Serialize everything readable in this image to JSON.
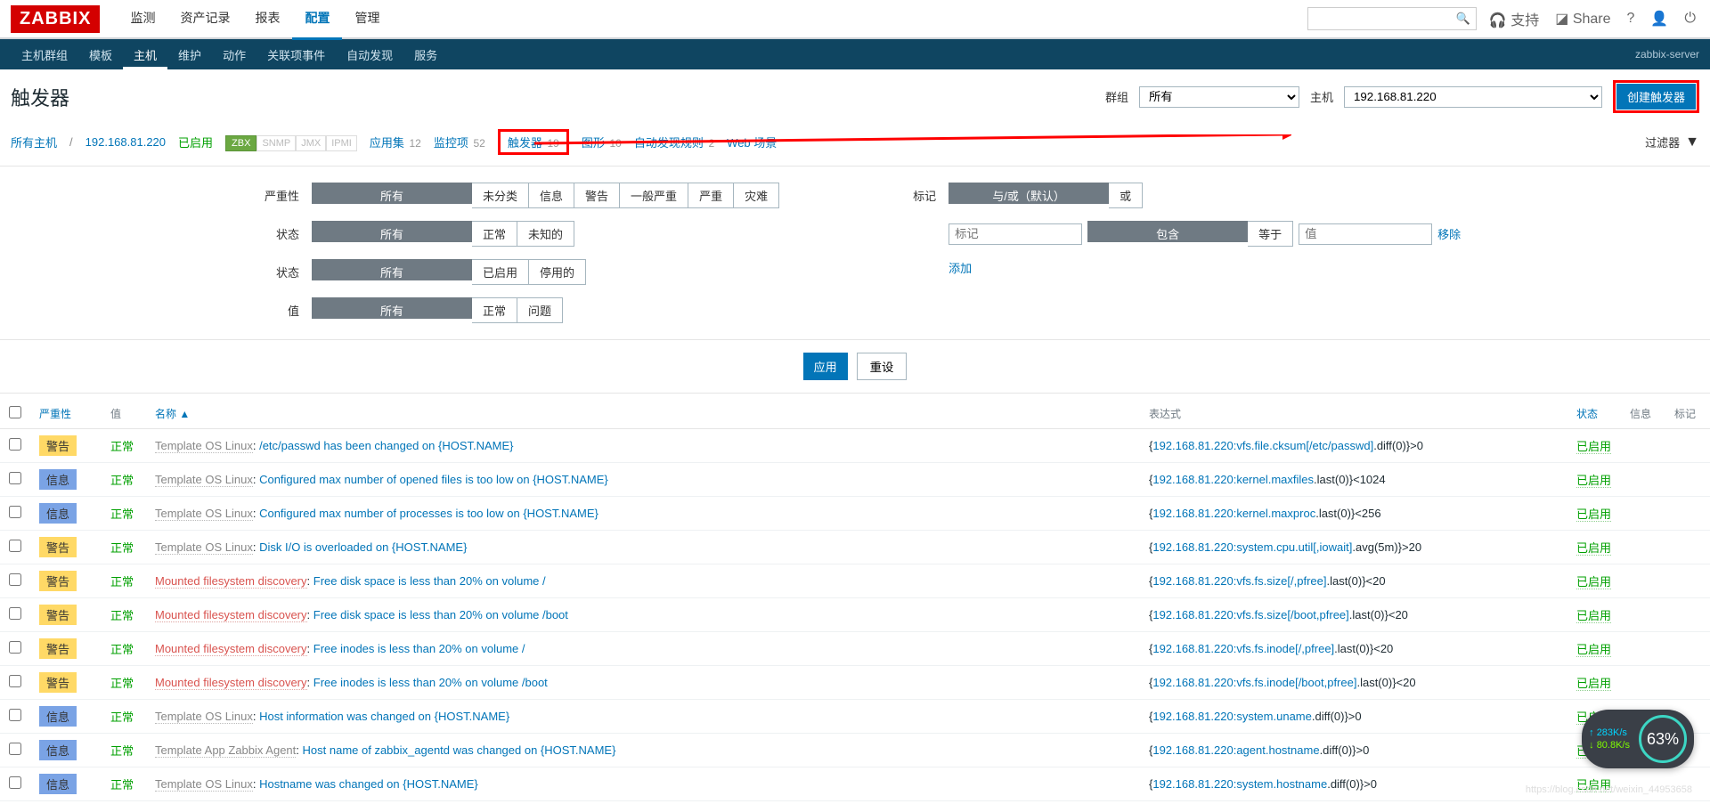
{
  "logo": "ZABBIX",
  "topnav": {
    "items": [
      "监测",
      "资产记录",
      "报表",
      "配置",
      "管理"
    ],
    "active": 3
  },
  "topright": {
    "support": "支持",
    "share": "Share"
  },
  "subnav": {
    "items": [
      "主机群组",
      "模板",
      "主机",
      "维护",
      "动作",
      "关联项事件",
      "自动发现",
      "服务"
    ],
    "active": 2,
    "server": "zabbix-server"
  },
  "header": {
    "title": "触发器",
    "group_label": "群组",
    "group_value": "所有",
    "host_label": "主机",
    "host_value": "192.168.81.220",
    "create_btn": "创建触发器"
  },
  "tabs": {
    "all_hosts": "所有主机",
    "host": "192.168.81.220",
    "enabled": "已启用",
    "zbx": "ZBX",
    "snmp": "SNMP",
    "jmx": "JMX",
    "ipmi": "IPMI",
    "apps": "应用集",
    "apps_n": "12",
    "items": "监控项",
    "items_n": "52",
    "triggers": "触发器",
    "triggers_n": "19",
    "graphs": "图形",
    "graphs_n": "10",
    "discovery": "自动发现规则",
    "discovery_n": "2",
    "web": "Web 场景",
    "filter": "过滤器"
  },
  "filter": {
    "severity_lbl": "严重性",
    "severity_opts": [
      "所有",
      "未分类",
      "信息",
      "警告",
      "一般严重",
      "严重",
      "灾难"
    ],
    "state_lbl": "状态",
    "state_opts": [
      "所有",
      "正常",
      "未知的"
    ],
    "status_lbl": "状态",
    "status_opts": [
      "所有",
      "已启用",
      "停用的"
    ],
    "value_lbl": "值",
    "value_opts": [
      "所有",
      "正常",
      "问题"
    ],
    "tag_lbl": "标记",
    "tag_mode": [
      "与/或（默认）",
      "或"
    ],
    "tag_name_ph": "标记",
    "tag_op": [
      "包含",
      "等于"
    ],
    "tag_val_ph": "值",
    "remove": "移除",
    "add": "添加",
    "apply": "应用",
    "reset": "重设"
  },
  "cols": {
    "severity": "严重性",
    "value": "值",
    "name": "名称",
    "expr": "表达式",
    "status": "状态",
    "info": "信息",
    "tags": "标记"
  },
  "sev": {
    "warn": "警告",
    "info": "信息"
  },
  "vals": {
    "ok": "正常"
  },
  "status": {
    "enabled": "已启用"
  },
  "src": {
    "tpl_linux": "Template OS Linux",
    "mfs": "Mounted filesystem discovery",
    "tpl_agent": "Template App Zabbix Agent"
  },
  "rows": [
    {
      "sev": "warn",
      "src": "tpl_linux",
      "name": "/etc/passwd has been changed on {HOST.NAME}",
      "expr_l": "192.168.81.220:vfs.file.cksum[/etc/passwd]",
      "expr_r": ".diff(0)}>0"
    },
    {
      "sev": "info",
      "src": "tpl_linux",
      "name": "Configured max number of opened files is too low on {HOST.NAME}",
      "expr_l": "192.168.81.220:kernel.maxfiles",
      "expr_r": ".last(0)}<1024"
    },
    {
      "sev": "info",
      "src": "tpl_linux",
      "name": "Configured max number of processes is too low on {HOST.NAME}",
      "expr_l": "192.168.81.220:kernel.maxproc",
      "expr_r": ".last(0)}<256"
    },
    {
      "sev": "warn",
      "src": "tpl_linux",
      "name": "Disk I/O is overloaded on {HOST.NAME}",
      "expr_l": "192.168.81.220:system.cpu.util[,iowait]",
      "expr_r": ".avg(5m)}>20"
    },
    {
      "sev": "warn",
      "src": "mfs",
      "name": "Free disk space is less than 20% on volume /",
      "expr_l": "192.168.81.220:vfs.fs.size[/,pfree]",
      "expr_r": ".last(0)}<20"
    },
    {
      "sev": "warn",
      "src": "mfs",
      "name": "Free disk space is less than 20% on volume /boot",
      "expr_l": "192.168.81.220:vfs.fs.size[/boot,pfree]",
      "expr_r": ".last(0)}<20"
    },
    {
      "sev": "warn",
      "src": "mfs",
      "name": "Free inodes is less than 20% on volume /",
      "expr_l": "192.168.81.220:vfs.fs.inode[/,pfree]",
      "expr_r": ".last(0)}<20"
    },
    {
      "sev": "warn",
      "src": "mfs",
      "name": "Free inodes is less than 20% on volume /boot",
      "expr_l": "192.168.81.220:vfs.fs.inode[/boot,pfree]",
      "expr_r": ".last(0)}<20"
    },
    {
      "sev": "info",
      "src": "tpl_linux",
      "name": "Host information was changed on {HOST.NAME}",
      "expr_l": "192.168.81.220:system.uname",
      "expr_r": ".diff(0)}>0"
    },
    {
      "sev": "info",
      "src": "tpl_agent",
      "name": "Host name of zabbix_agentd was changed on {HOST.NAME}",
      "expr_l": "192.168.81.220:agent.hostname",
      "expr_r": ".diff(0)}>0"
    },
    {
      "sev": "info",
      "src": "tpl_linux",
      "name": "Hostname was changed on {HOST.NAME}",
      "expr_l": "192.168.81.220:system.hostname",
      "expr_r": ".diff(0)}>0"
    }
  ],
  "widget": {
    "up": "283K/s",
    "down": "80.8K/s",
    "pct": "63%"
  },
  "watermark": "https://blog.csdn.net/weixin_44953658"
}
